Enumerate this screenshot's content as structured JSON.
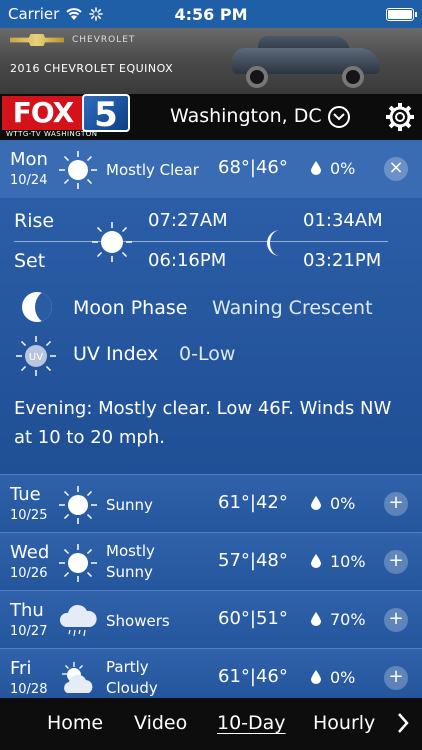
{
  "status_bar": {
    "carrier": "Carrier",
    "time": "4:56 PM"
  },
  "ad": {
    "brand": "CHEVROLET",
    "model": "2016 CHEVROLET EQUINOX"
  },
  "header": {
    "logo_fox": "FOX",
    "logo_five": "5",
    "logo_sub": "WTTG-TV WASHINGTON",
    "location": "Washington, DC"
  },
  "today": {
    "day": "Mon",
    "date": "10/24",
    "condition": "Mostly Clear",
    "temps": "68°|46°",
    "precip": "0%",
    "toggle": "×",
    "rise_label": "Rise",
    "set_label": "Set",
    "sunrise": "07:27AM",
    "sunset": "06:16PM",
    "moonrise": "01:34AM",
    "moonset": "03:21PM",
    "moon_phase_label": "Moon Phase",
    "moon_phase": "Waning Crescent",
    "uv_label": "UV Index",
    "uv_value": "0-Low",
    "forecast_text": "Evening: Mostly clear. Low 46F. Winds NW at 10 to 20 mph."
  },
  "days": [
    {
      "day": "Tue",
      "date": "10/25",
      "condition": "Sunny",
      "condition2": "",
      "temps": "61°|42°",
      "precip": "0%",
      "icon": "sun-icon"
    },
    {
      "day": "Wed",
      "date": "10/26",
      "condition": "Mostly",
      "condition2": "Sunny",
      "temps": "57°|48°",
      "precip": "10%",
      "icon": "sun-icon"
    },
    {
      "day": "Thu",
      "date": "10/27",
      "condition": "Showers",
      "condition2": "",
      "temps": "60°|51°",
      "precip": "70%",
      "icon": "rain-cloud-icon"
    },
    {
      "day": "Fri",
      "date": "10/28",
      "condition": "Partly",
      "condition2": "Cloudy",
      "temps": "61°|46°",
      "precip": "0%",
      "icon": "partly-cloudy-icon"
    }
  ],
  "expand_glyph": "+",
  "uv_badge": "UV",
  "tabs": {
    "home": "Home",
    "video": "Video",
    "ten_day": "10-Day",
    "hourly": "Hourly"
  }
}
